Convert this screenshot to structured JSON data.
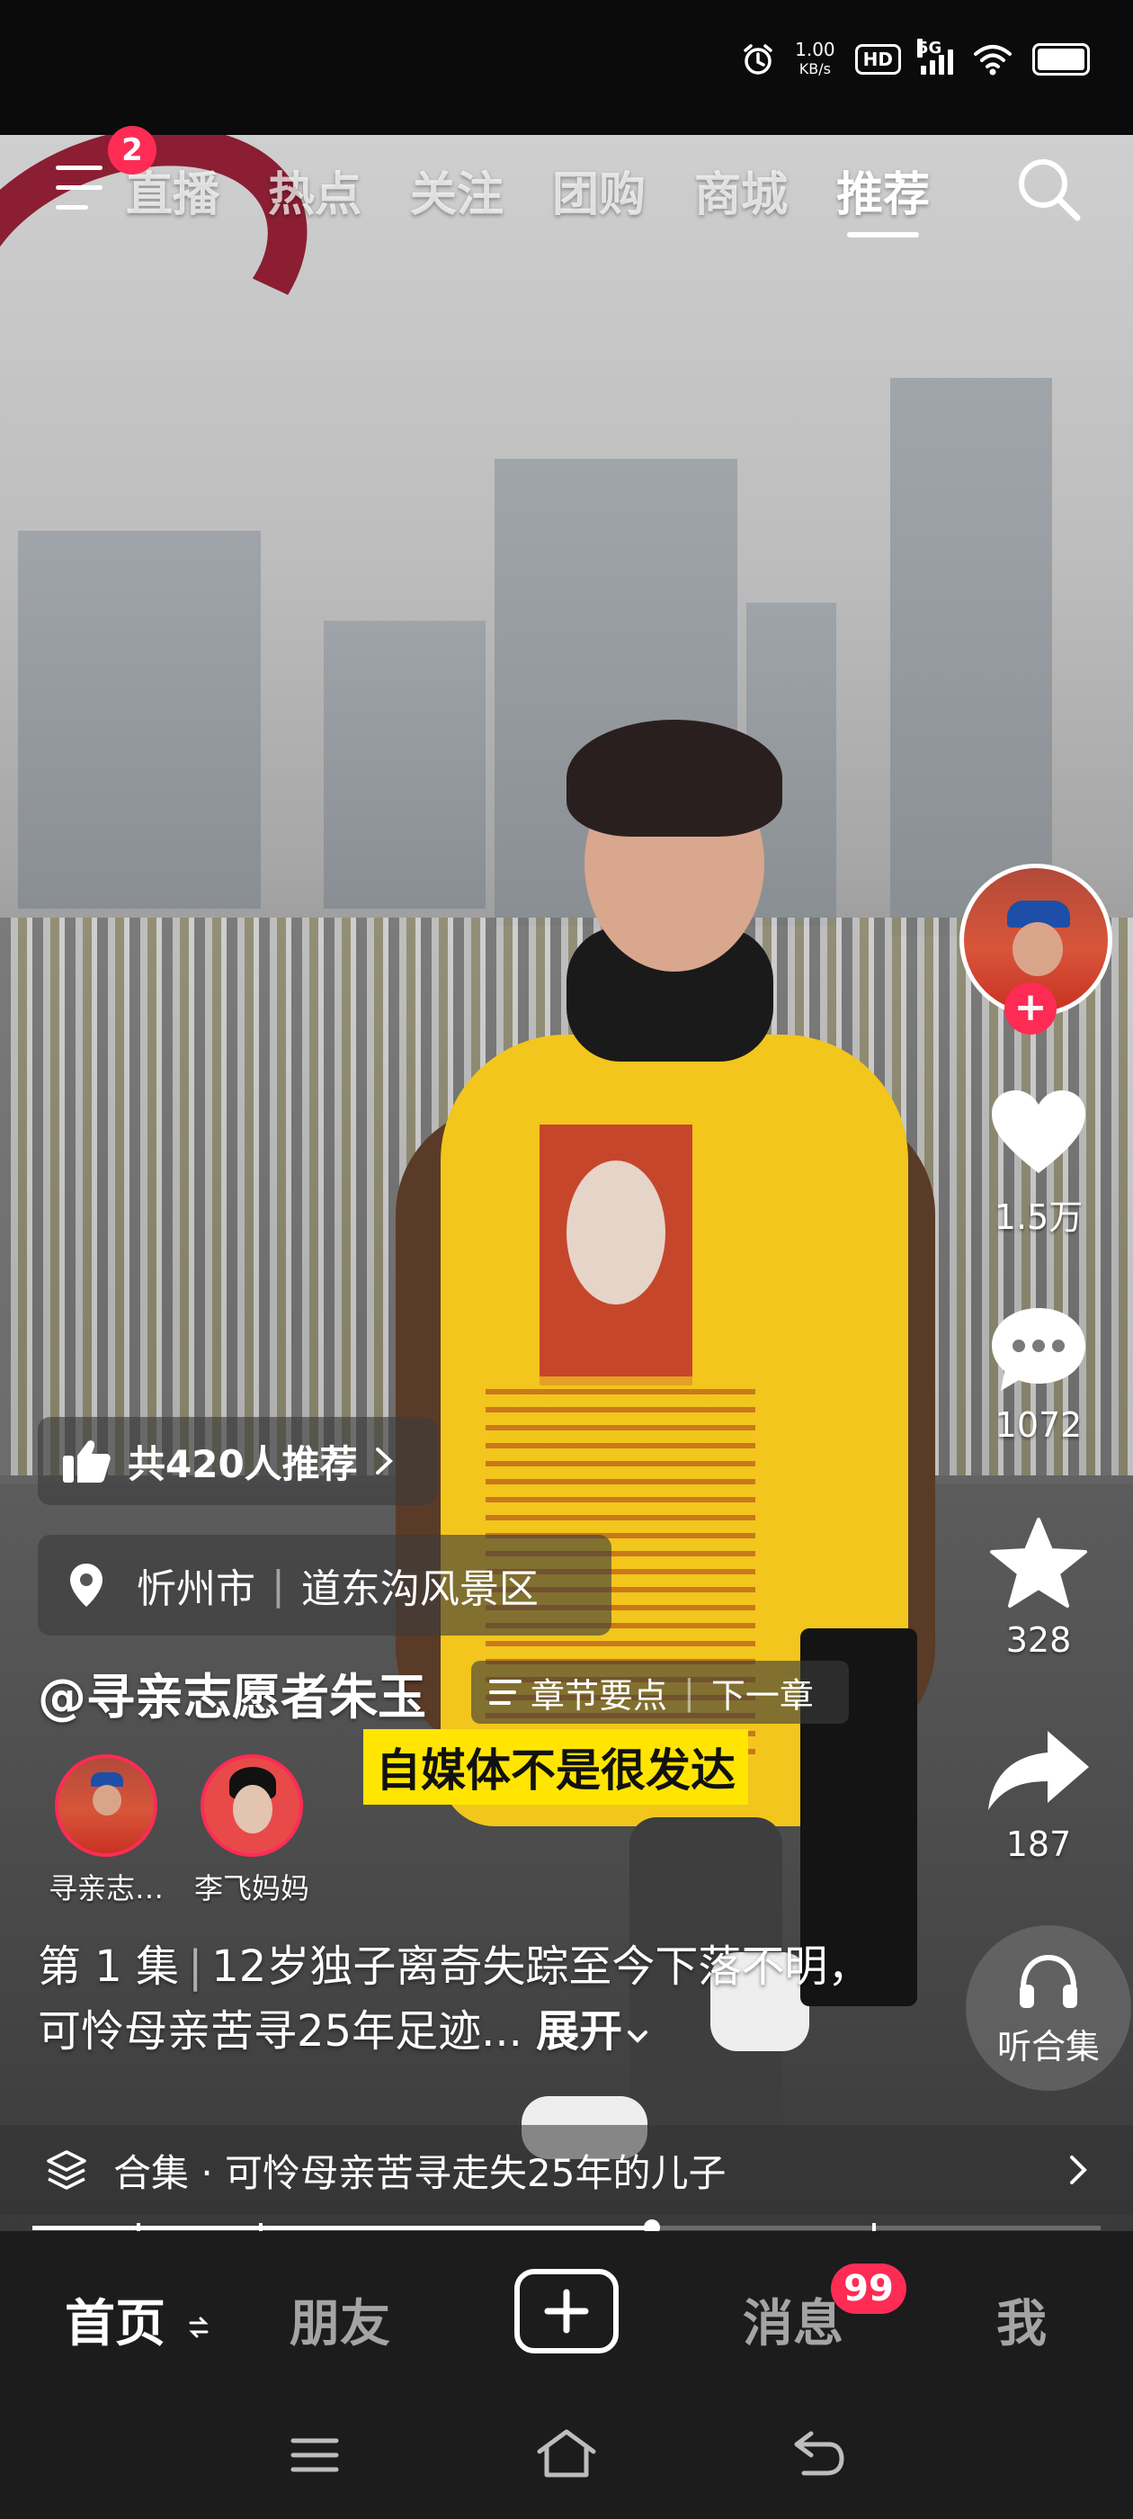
{
  "status_bar": {
    "net_speed_value": "1.00",
    "net_speed_unit": "KB/s",
    "hd_label": "HD",
    "network_label": "5G",
    "icons": [
      "alarm-icon",
      "hd-icon",
      "signal-icon",
      "wifi-icon",
      "battery-icon"
    ]
  },
  "top_nav": {
    "menu_badge": "2",
    "tabs": [
      {
        "label": "直播",
        "active": false
      },
      {
        "label": "热点",
        "active": false
      },
      {
        "label": "关注",
        "active": false
      },
      {
        "label": "团购",
        "active": false
      },
      {
        "label": "商城",
        "active": false
      },
      {
        "label": "推荐",
        "active": true
      }
    ]
  },
  "side_actions": {
    "like_count": "1.5万",
    "comment_count": "1072",
    "favorite_count": "328",
    "share_count": "187",
    "listen_label": "听合集"
  },
  "video_info": {
    "recommend_text": "共420人推荐",
    "location_city": "忻州市",
    "location_place": "道东沟风景区",
    "author": "@寻亲志愿者朱玉",
    "chapter_label": "章节要点",
    "next_label": "下一章",
    "subtitle": "自媒体不是很发达",
    "collaborators": [
      {
        "name": "寻亲志…"
      },
      {
        "name": "李飞妈妈"
      }
    ],
    "episode": "第 1 集",
    "caption": "12岁独子离奇失踪至今下落不明，可怜母亲苦寻25年足迹...",
    "expand_label": "展开",
    "collection_label": "合集 · 可怜母亲苦寻走失25年的儿子",
    "progress": 0.58
  },
  "bottom_nav": {
    "home": "首页",
    "friends": "朋友",
    "messages": "消息",
    "messages_badge": "99",
    "me": "我"
  },
  "colors": {
    "accent": "#fe2c55",
    "subtitle_bg": "#ffe500"
  }
}
